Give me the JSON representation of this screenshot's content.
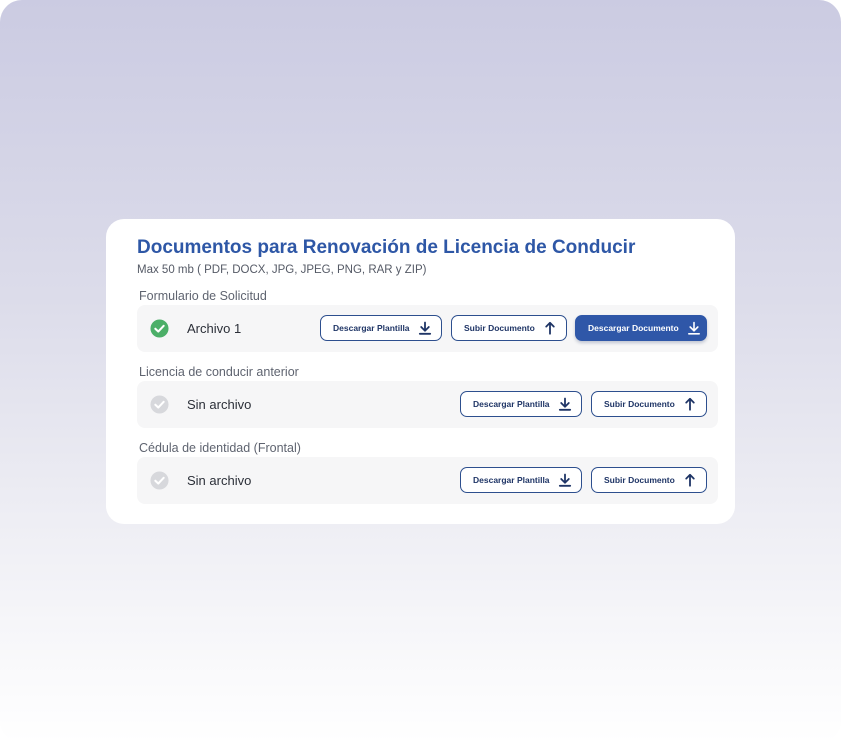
{
  "card": {
    "title": "Documentos para Renovación de Licencia de Conducir",
    "subtitle": "Max 50 mb ( PDF, DOCX, JPG, JPEG, PNG, RAR y ZIP)"
  },
  "sections": [
    {
      "label": "Formulario de Solicitud",
      "status": "uploaded",
      "file_name": "Archivo 1",
      "download_template_label": "Descargar Plantilla",
      "upload_label": "Subir Documento",
      "download_document_label": "Descargar Documento"
    },
    {
      "label": "Licencia de conducir anterior",
      "status": "empty",
      "file_name": "Sin archivo",
      "download_template_label": "Descargar Plantilla",
      "upload_label": "Subir Documento"
    },
    {
      "label": "Cédula de identidad (Frontal)",
      "status": "empty",
      "file_name": "Sin archivo",
      "download_template_label": "Descargar Plantilla",
      "upload_label": "Subir Documento"
    }
  ],
  "icons": {
    "check_uploaded": "check-circle-icon",
    "check_empty": "check-circle-icon",
    "download": "download-icon",
    "upload": "upload-icon"
  },
  "colors": {
    "accent": "#2f57a8",
    "title": "#2e57a6",
    "success": "#4caf68",
    "inactive": "#d7d8dc",
    "row_background": "#f6f6f7"
  }
}
